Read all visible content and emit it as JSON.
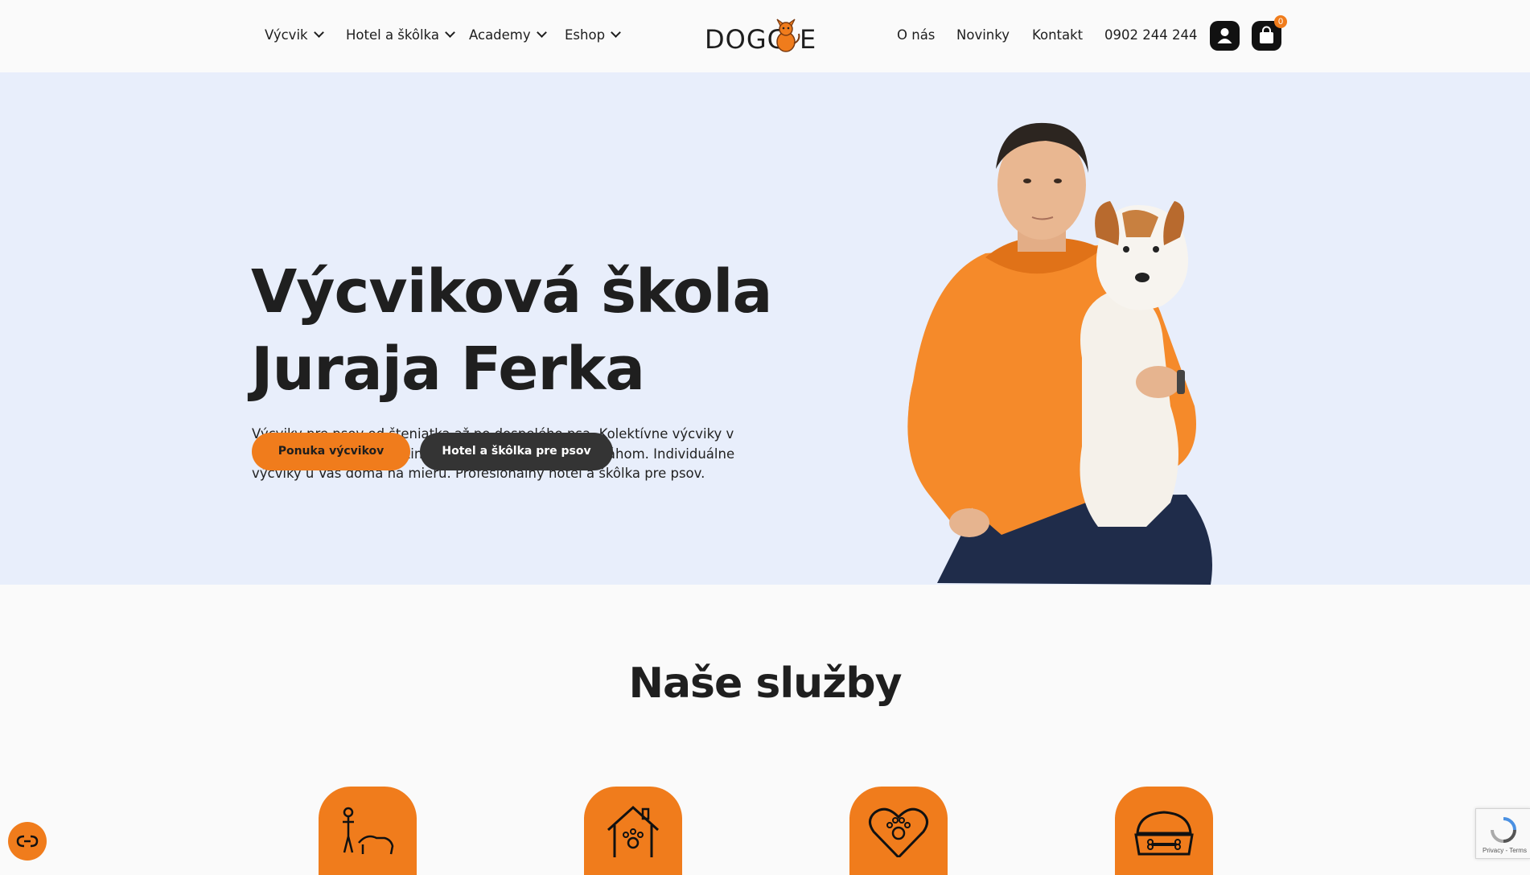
{
  "header": {
    "nav_left": [
      {
        "label": "Výcvik"
      },
      {
        "label": "Hotel a škôlka"
      },
      {
        "label": "Academy"
      },
      {
        "label": "Eshop"
      }
    ],
    "logo_text": "DOGG",
    "logo_text_end": "E",
    "nav_right": [
      {
        "label": "O nás"
      },
      {
        "label": "Novinky"
      },
      {
        "label": "Kontakt"
      },
      {
        "label": "0902 244 244"
      }
    ],
    "cart_count": "0",
    "icons": {
      "account": "user-icon",
      "cart": "shopping-bag-icon"
    }
  },
  "hero": {
    "title_line1": "Výcviková škola",
    "title_line2": "Juraja Ferka",
    "description": "Výcviky pre psov od šteniatka až po dospelého psa. Kolektívne výcviky v mestách Bratislava, Pezinok, Nitra, Nové Mesto nad Váhom. Individuálne výcviky u Vás doma na mieru. Profesionálny hotel a škôlka pre psov.",
    "primary_button": "Ponuka výcvikov",
    "secondary_button": "Hotel a škôlka pre psov"
  },
  "services": {
    "title": "Naše služby",
    "icons": [
      "dog-training-icon",
      "dog-house-icon",
      "heart-paw-icon",
      "dog-bowl-icon"
    ]
  },
  "recaptcha": {
    "text": "Privacy - Terms"
  },
  "colors": {
    "accent": "#f07c1c",
    "hero_bg": "#e8eefb",
    "dark": "#343434",
    "text": "#1e1e1e"
  }
}
